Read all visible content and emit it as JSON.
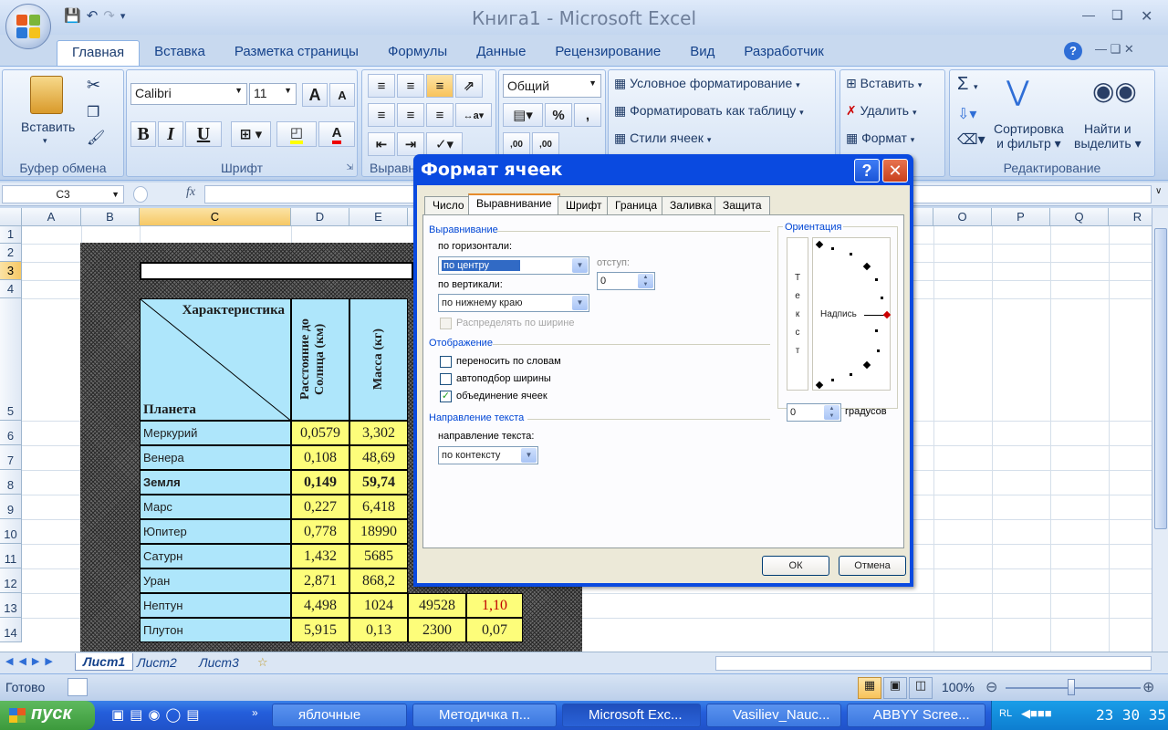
{
  "window": {
    "title": "Книга1 - Microsoft Excel"
  },
  "ribbon_tabs": [
    "Главная",
    "Вставка",
    "Разметка страницы",
    "Формулы",
    "Данные",
    "Рецензирование",
    "Вид",
    "Разработчик"
  ],
  "clipboard": {
    "paste": "Вставить",
    "label": "Буфер обмена"
  },
  "font": {
    "name": "Calibri",
    "size": "11",
    "bold": "B",
    "italic": "I",
    "underline": "U",
    "grow": "A",
    "shrink": "A",
    "label": "Шрифт"
  },
  "alignment": {
    "label": "Выравн"
  },
  "number": {
    "format": "Общий",
    "percent": "%",
    "comma": ",",
    "dec_inc": ",00",
    "dec_dec": ",00"
  },
  "styles": {
    "conditional": "Условное форматирование",
    "as_table": "Форматировать как таблицу",
    "cell_styles": "Стили ячеек"
  },
  "cells": {
    "insert": "Вставить",
    "delete": "Удалить",
    "format": "Формат"
  },
  "editing": {
    "sigma": "Σ",
    "sort1": "Сортировка",
    "sort2": "и фильтр",
    "find1": "Найти и",
    "find2": "выделить",
    "label": "Редактирование"
  },
  "formula_bar": {
    "cell_ref": "C3",
    "fx": "fx"
  },
  "columns": [
    "A",
    "B",
    "C",
    "D",
    "E",
    "",
    "",
    "",
    "",
    "",
    "",
    "",
    "O",
    "P",
    "Q",
    "R"
  ],
  "rows": [
    "1",
    "2",
    "3",
    "4",
    "5",
    "6",
    "7",
    "8",
    "9",
    "10",
    "11",
    "12",
    "13",
    "14"
  ],
  "table": {
    "header_char": "Характеристика",
    "header_planet": "Планета",
    "col_dist": "Расстояние до Солнца (км)",
    "col_mass": "Масса (кг)",
    "planets": [
      {
        "name": "Меркурий",
        "dist": "0,0579",
        "mass": "3,302"
      },
      {
        "name": "Венера",
        "dist": "0,108",
        "mass": "48,69"
      },
      {
        "name": "Земля",
        "dist": "0,149",
        "mass": "59,74"
      },
      {
        "name": "Марс",
        "dist": "0,227",
        "mass": "6,418"
      },
      {
        "name": "Юпитер",
        "dist": "0,778",
        "mass": "18990"
      },
      {
        "name": "Сатурн",
        "dist": "1,432",
        "mass": "5685"
      },
      {
        "name": "Уран",
        "dist": "2,871",
        "mass": "868,2"
      },
      {
        "name": "Нептун",
        "dist": "4,498",
        "mass": "1024",
        "c3": "49528",
        "c4": "1,10"
      },
      {
        "name": "Плутон",
        "dist": "5,915",
        "mass": "0,13",
        "c3": "2300",
        "c4": "0,07"
      }
    ]
  },
  "sheet_tabs": [
    "Лист1",
    "Лист2",
    "Лист3"
  ],
  "status": {
    "ready": "Готово",
    "zoom": "100%"
  },
  "taskbar": {
    "start": "пуск",
    "items": [
      "яблочные",
      "Методичка п...",
      "Microsoft Exc...",
      "Vasiliev_Nauc...",
      "ABBYY Scree..."
    ],
    "lang": "RL",
    "clock": "23 30 35"
  },
  "dialog": {
    "title": "Формат ячеек",
    "tabs": [
      "Число",
      "Выравнивание",
      "Шрифт",
      "Граница",
      "Заливка",
      "Защита"
    ],
    "alignment_section": "Выравнивание",
    "horizontal_label": "по горизонтали:",
    "horizontal_value": "по центру",
    "indent_label": "отступ:",
    "indent_value": "0",
    "vertical_label": "по вертикали:",
    "vertical_value": "по нижнему краю",
    "distribute": "Распределять по ширине",
    "display_section": "Отображение",
    "wrap": "переносить по словам",
    "shrink": "автоподбор ширины",
    "merge": "объединение ячеек",
    "direction_section": "Направление текста",
    "direction_label": "направление текста:",
    "direction_value": "по контексту",
    "orientation_section": "Ориентация",
    "vertical_text": "Т е к с т",
    "orientation_label": "Надпись",
    "degrees_value": "0",
    "degrees_label": "градусов",
    "ok": "ОК",
    "cancel": "Отмена"
  }
}
